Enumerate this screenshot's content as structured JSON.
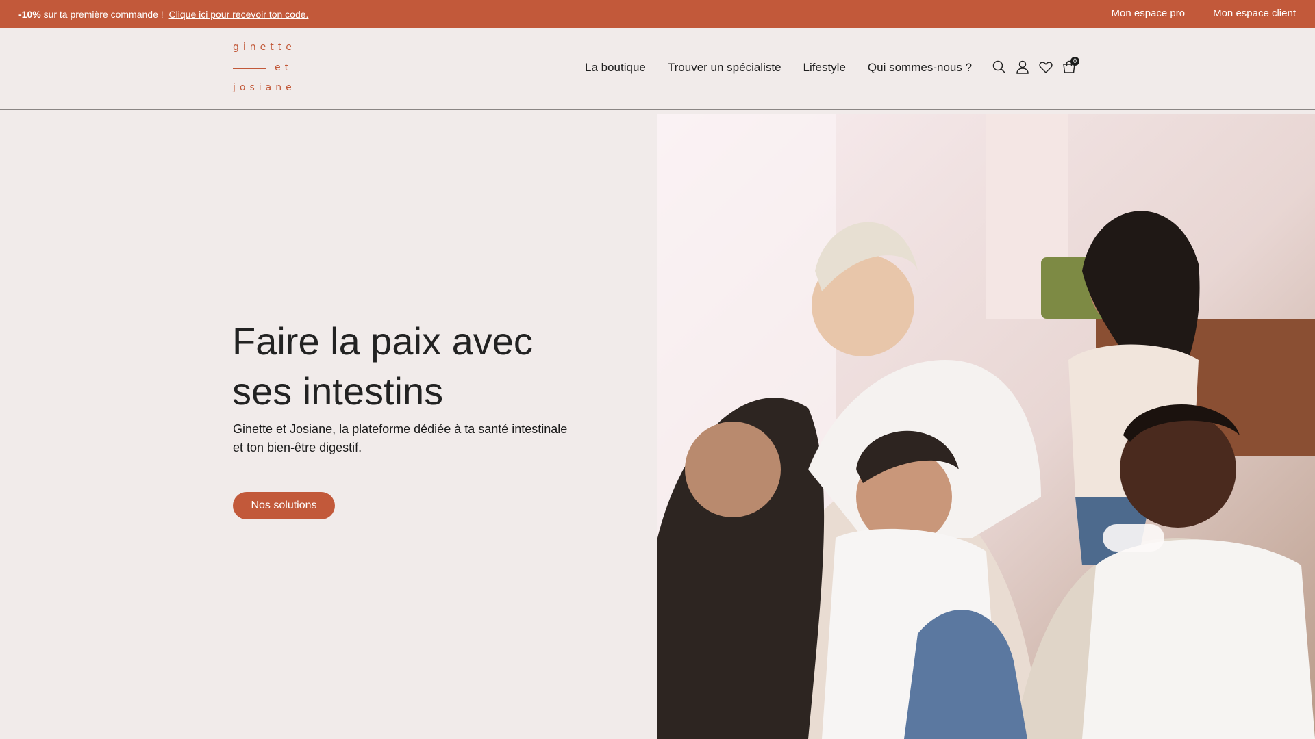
{
  "topbar": {
    "promo_bold": "-10%",
    "promo_text": "sur ta première commande !",
    "promo_link": "Clique ici pour recevoir ton code.",
    "links": [
      "Mon espace pro",
      "Mon espace client"
    ],
    "background": "#c2593a"
  },
  "header": {
    "logo": {
      "line1": "ginette",
      "line2": "et",
      "line3": "josiane"
    },
    "nav": [
      "La boutique",
      "Trouver un spécialiste",
      "Lifestyle",
      "Qui sommes-nous ?"
    ],
    "icons": [
      "search-icon",
      "user-icon",
      "heart-icon",
      "cart-icon"
    ],
    "cart_count": "0"
  },
  "hero": {
    "title_line1": "Faire la paix avec",
    "title_line2": "ses intestins",
    "subtitle_line1": "Ginette et Josiane, la plateforme dédiée à ta santé intestinale",
    "subtitle_line2": "et ton bien-être digestif.",
    "cta_label": "Nos solutions",
    "accent": "#c2593a",
    "background": "#f1ebea"
  }
}
